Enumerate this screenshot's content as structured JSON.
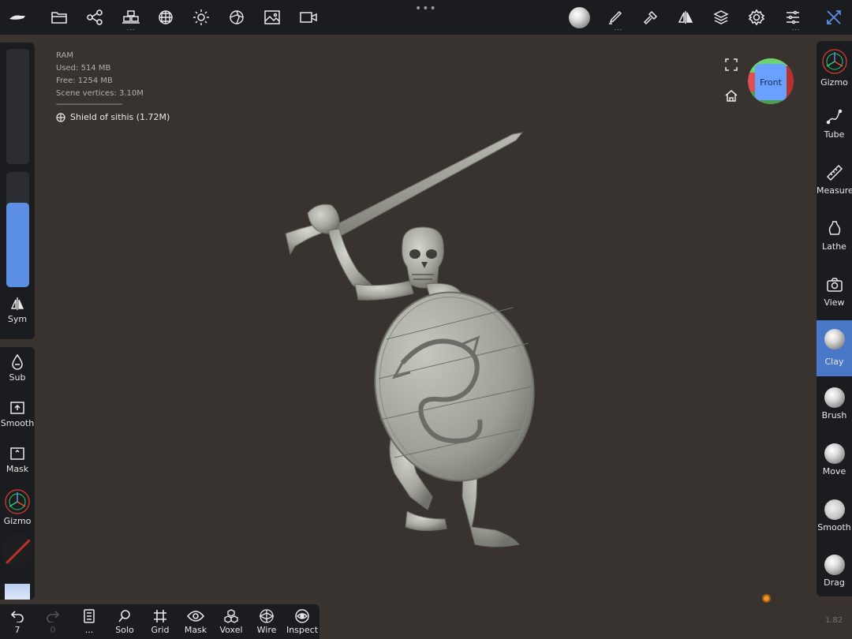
{
  "top_toolbar": {
    "icons": [
      "nomad-logo-icon",
      "folder-icon",
      "scene-tree-icon",
      "primitives-icon",
      "material-sphere-icon",
      "light-icon",
      "shading-icon",
      "background-image-icon",
      "camera-icon",
      "matcap-icon",
      "paint-icon",
      "hammer-icon",
      "symmetry-icon",
      "layers-icon",
      "settings-icon",
      "sliders-icon",
      "tools-icon"
    ]
  },
  "info": {
    "ram_label": "RAM",
    "used": "Used:  514 MB",
    "free": "Free:  1254 MB",
    "scene_vertices": "Scene vertices:  3.10M",
    "divider": "--------------------------------",
    "mesh_name": "Shield of sithis (1.72M)"
  },
  "view_cube": {
    "face_label": "Front"
  },
  "left_panel": {
    "radius_slider_level": 0.0,
    "intensity_slider_level": 0.73,
    "sym_label": "Sym",
    "tools": [
      {
        "label": "Sub"
      },
      {
        "label": "Smooth"
      },
      {
        "label": "Mask"
      },
      {
        "label": "Gizmo"
      }
    ]
  },
  "right_panel": {
    "tools": [
      {
        "label": "Gizmo"
      },
      {
        "label": "Tube"
      },
      {
        "label": "Measure"
      },
      {
        "label": "Lathe"
      },
      {
        "label": "View"
      },
      {
        "label": "Clay"
      },
      {
        "label": "Brush"
      },
      {
        "label": "Move"
      },
      {
        "label": "Smooth"
      },
      {
        "label": "Drag"
      }
    ],
    "active_tool": "Clay"
  },
  "bottom_toolbar": {
    "undo_count": "7",
    "redo_count": "0",
    "more": "...",
    "items": [
      {
        "label": "Solo"
      },
      {
        "label": "Grid"
      },
      {
        "label": "Mask"
      },
      {
        "label": "Voxel"
      },
      {
        "label": "Wire"
      },
      {
        "label": "Inspect"
      }
    ]
  },
  "version": "1.82",
  "colors": {
    "accent": "#5b8ee5",
    "active_tool_bg": "#4a78c8",
    "viewport_bg": "#38332f",
    "panel_bg": "#1b1c20"
  }
}
